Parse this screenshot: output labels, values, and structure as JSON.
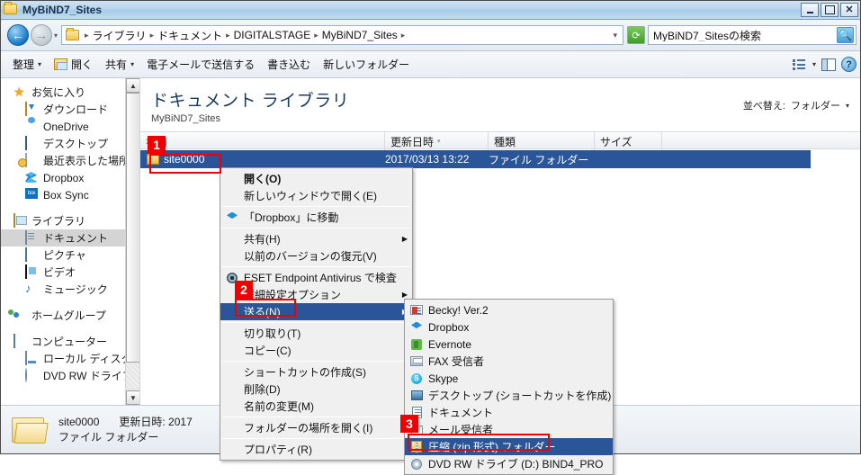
{
  "window": {
    "title": "MyBiND7_Sites",
    "controls": {
      "minimize": "_",
      "maximize": "□",
      "close": "✕"
    }
  },
  "address": {
    "back_label": "←",
    "forward_label": "→",
    "dropdown": "▾",
    "crumbs": [
      "ライブラリ",
      "ドキュメント",
      "DIGITALSTAGE",
      "MyBiND7_Sites"
    ],
    "separator": "▸",
    "end_caret": "▾",
    "refresh_label": "⟳"
  },
  "search": {
    "value": "MyBiND7_Sitesの検索",
    "placeholder": "MyBiND7_Sitesの検索",
    "icon": "search-icon"
  },
  "commandbar": {
    "organize": "整理",
    "open": "開く",
    "share": "共有",
    "email": "電子メールで送信する",
    "burn": "書き込む",
    "newfolder": "新しいフォルダー",
    "caret": "▾"
  },
  "sidebar": {
    "groups": [
      {
        "header": {
          "label": "お気に入り",
          "icon": "star-icon"
        },
        "items": [
          {
            "label": "ダウンロード",
            "icon": "download-folder-icon"
          },
          {
            "label": "OneDrive",
            "icon": "onedrive-cloud-icon"
          },
          {
            "label": "デスクトップ",
            "icon": "desktop-icon"
          },
          {
            "label": "最近表示した場所",
            "icon": "recent-places-icon"
          },
          {
            "label": "Dropbox",
            "icon": "dropbox-icon"
          },
          {
            "label": "Box Sync",
            "icon": "box-sync-icon"
          }
        ]
      },
      {
        "header": {
          "label": "ライブラリ",
          "icon": "library-icon"
        },
        "items": [
          {
            "label": "ドキュメント",
            "icon": "documents-icon",
            "selected": true
          },
          {
            "label": "ピクチャ",
            "icon": "pictures-icon"
          },
          {
            "label": "ビデオ",
            "icon": "videos-icon"
          },
          {
            "label": "ミュージック",
            "icon": "music-icon"
          }
        ]
      },
      {
        "header": {
          "label": "ホームグループ",
          "icon": "homegroup-icon"
        },
        "items": []
      },
      {
        "header": {
          "label": "コンピューター",
          "icon": "computer-icon"
        },
        "items": [
          {
            "label": "ローカル ディスク (",
            "icon": "local-disk-icon"
          },
          {
            "label": "DVD RW ドライブ",
            "icon": "dvd-drive-icon"
          }
        ]
      }
    ],
    "scroll_up": "▲",
    "scroll_down": "▼"
  },
  "main": {
    "library_title": "ドキュメント ライブラリ",
    "library_subtitle": "MyBiND7_Sites",
    "sort_label": "並べ替え:",
    "sort_value": "フォルダー",
    "sort_caret": "▾",
    "columns": [
      {
        "label": "名前",
        "sorted": false
      },
      {
        "label": "更新日時",
        "sorted": true,
        "caret": "▾"
      },
      {
        "label": "種類",
        "sorted": false
      },
      {
        "label": "サイズ",
        "sorted": false
      }
    ],
    "rows": [
      {
        "name": "site0000",
        "date": "2017/03/13 13:22",
        "type": "ファイル フォルダー",
        "size": "",
        "selected": true,
        "icon": "folder-icon"
      }
    ]
  },
  "statusbar": {
    "name": "site0000",
    "date_label": "更新日時: 2017",
    "type": "ファイル フォルダー",
    "icon": "folder-large-icon"
  },
  "context_menu": {
    "items": [
      {
        "label": "開く(O)",
        "bold": true,
        "icon": null,
        "sep_after": false
      },
      {
        "label": "新しいウィンドウで開く(E)",
        "bold": false,
        "icon": null,
        "sep_after": true
      },
      {
        "label": "「Dropbox」に移動",
        "bold": false,
        "icon": "dropbox-icon",
        "sep_after": true
      },
      {
        "label": "共有(H)",
        "bold": false,
        "icon": null,
        "arrow": "▶",
        "sep_after": false
      },
      {
        "label": "以前のバージョンの復元(V)",
        "bold": false,
        "icon": null,
        "sep_after": true
      },
      {
        "label": "ESET Endpoint Antivirus で検査",
        "bold": false,
        "icon": "eset-icon",
        "sep_after": false
      },
      {
        "label": "詳細設定オプション",
        "bold": false,
        "icon": null,
        "arrow": "▶",
        "sep_after": false
      },
      {
        "label": "送る(N)",
        "bold": false,
        "icon": null,
        "arrow": "▶",
        "highlighted": true,
        "sep_after": true
      },
      {
        "label": "切り取り(T)",
        "bold": false,
        "icon": null,
        "sep_after": false
      },
      {
        "label": "コピー(C)",
        "bold": false,
        "icon": null,
        "sep_after": true
      },
      {
        "label": "ショートカットの作成(S)",
        "bold": false,
        "icon": null,
        "sep_after": false
      },
      {
        "label": "削除(D)",
        "bold": false,
        "icon": null,
        "sep_after": false
      },
      {
        "label": "名前の変更(M)",
        "bold": false,
        "icon": null,
        "sep_after": true
      },
      {
        "label": "フォルダーの場所を開く(I)",
        "bold": false,
        "icon": null,
        "sep_after": true
      },
      {
        "label": "プロパティ(R)",
        "bold": false,
        "icon": null,
        "sep_after": false
      }
    ]
  },
  "send_to_menu": {
    "items": [
      {
        "label": "Becky! Ver.2",
        "icon": "becky-icon"
      },
      {
        "label": "Dropbox",
        "icon": "dropbox-icon"
      },
      {
        "label": "Evernote",
        "icon": "evernote-icon"
      },
      {
        "label": "FAX 受信者",
        "icon": "fax-icon"
      },
      {
        "label": "Skype",
        "icon": "skype-icon"
      },
      {
        "label": "デスクトップ (ショートカットを作成)",
        "icon": "desktop-icon"
      },
      {
        "label": "ドキュメント",
        "icon": "documents-icon"
      },
      {
        "label": "メール受信者",
        "icon": "mail-icon"
      },
      {
        "label": "圧縮 (zip 形式) フォルダー",
        "icon": "zip-folder-icon",
        "highlighted": true
      },
      {
        "label": "DVD RW ドライブ (D:) BIND4_PRO",
        "icon": "dvd-drive-icon"
      }
    ]
  },
  "annotations": {
    "badges": [
      {
        "number": "1",
        "target": "file-row-site0000"
      },
      {
        "number": "2",
        "target": "context-menu-send-to"
      },
      {
        "number": "3",
        "target": "send-to-zip-folder"
      }
    ],
    "accent_color": "#ee0000",
    "selection_color": "#2a5699"
  }
}
